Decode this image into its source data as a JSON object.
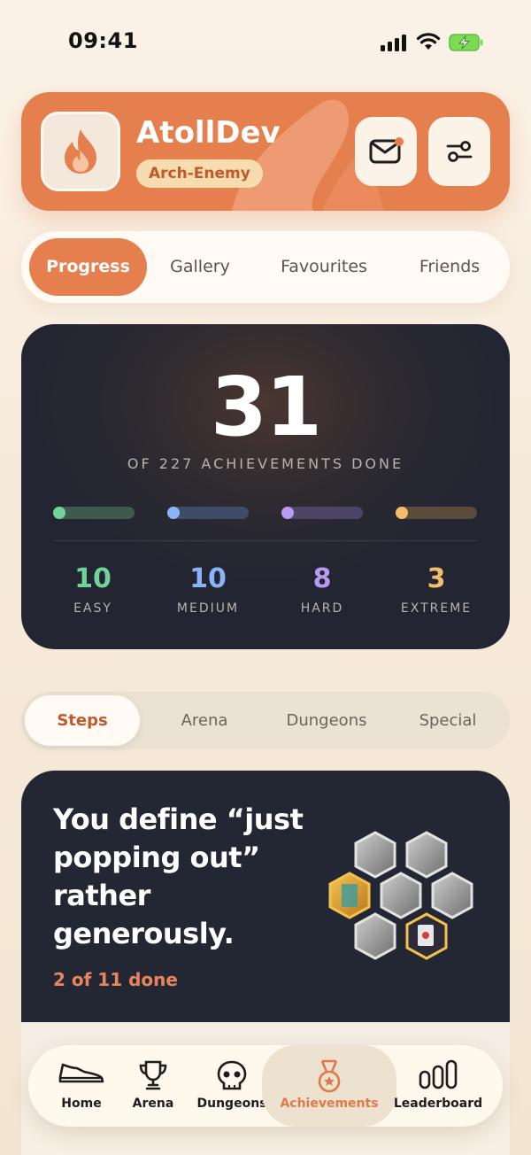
{
  "status_bar": {
    "time": "09:41"
  },
  "profile": {
    "username": "AtollDev",
    "rank": "Arch-Enemy"
  },
  "top_tabs": [
    "Progress",
    "Gallery",
    "Favourites",
    "Friends"
  ],
  "stats": {
    "total_done": "31",
    "subtitle": "OF 227 ACHIEVEMENTS DONE",
    "difficulties": [
      {
        "label": "EASY",
        "count": "10",
        "color": "#6fd39a"
      },
      {
        "label": "MEDIUM",
        "count": "10",
        "color": "#8ab4f8"
      },
      {
        "label": "HARD",
        "count": "8",
        "color": "#b99af2"
      },
      {
        "label": "EXTREME",
        "count": "3",
        "color": "#f3bd6a"
      }
    ]
  },
  "category_tabs": [
    "Steps",
    "Arena",
    "Dungeons",
    "Special"
  ],
  "achievement": {
    "title": "You define “just popping out” rather generously.",
    "progress": "2 of 11 done"
  },
  "bottom_nav": [
    "Home",
    "Arena",
    "Dungeons",
    "Achievements",
    "Leaderboard"
  ],
  "colors": {
    "accent": "#e57f4e",
    "card_dark": "#232733"
  }
}
